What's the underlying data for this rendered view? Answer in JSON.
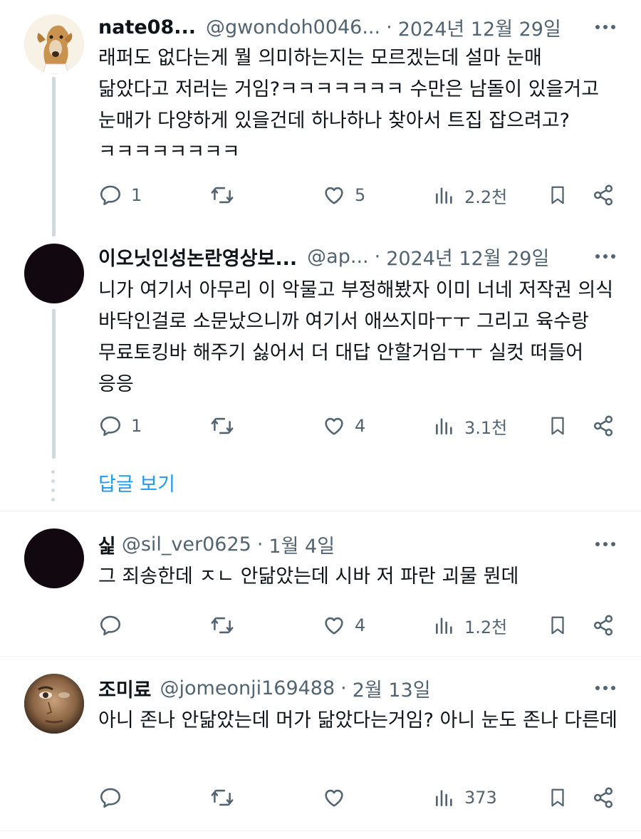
{
  "tweets": [
    {
      "name": "nate08...",
      "handle": "@gwondoh0046...",
      "sep": "·",
      "date": "2024년 12월 29일",
      "text": "래퍼도 없다는게 뭘 의미하는지는 모르겠는데 설마 눈매 닮았다고 저러는 거임?ㅋㅋㅋㅋㅋㅋㅋ 수만은 남돌이 있을거고 눈매가 다양하게 있을건데 하나하나 찾아서 트집 잡으려고?ㅋㅋㅋㅋㅋㅋㅋㅋ",
      "replies": "1",
      "retweets": "",
      "likes": "5",
      "views": "2.2천"
    },
    {
      "name": "이오닛인성논란영상보...",
      "handle": "@ap...",
      "sep": "·",
      "date": "2024년 12월 29일",
      "text": "니가 여기서 아무리 이 악물고 부정해봤자 이미 너네 저작권 의식 바닥인걸로 소문났으니까 여기서 애쓰지마ㅜㅜ 그리고 육수랑 무료토킹바 해주기 싫어서 더 대답 안할거임ㅜㅜ 실컷 떠들어 응응",
      "replies": "1",
      "retweets": "",
      "likes": "4",
      "views": "3.1천"
    },
    {
      "name": "싩",
      "handle": "@sil_ver0625",
      "sep": "·",
      "date": "1월 4일",
      "text": "그 죄송한데 ㅈㄴ 안닮았는데 시바 저 파란 괴물 뭔데",
      "replies": "",
      "retweets": "",
      "likes": "4",
      "views": "1.2천"
    },
    {
      "name": "조미료",
      "handle": "@jomeonji169488",
      "sep": "·",
      "date": "2월 13일",
      "text": "아니 존나 안닮았는데 머가 닮았다는거임? 아니 눈도 존나 다른데",
      "replies": "",
      "retweets": "",
      "likes": "",
      "views": "373"
    }
  ],
  "show_replies": "답글 보기",
  "colors": {
    "text": "#0f1419",
    "secondary": "#536471",
    "link": "#1d9bf0",
    "thread": "#cfd9de"
  },
  "icons": [
    "reply-icon",
    "retweet-icon",
    "like-icon",
    "views-icon",
    "bookmark-icon",
    "share-icon",
    "more-icon"
  ]
}
